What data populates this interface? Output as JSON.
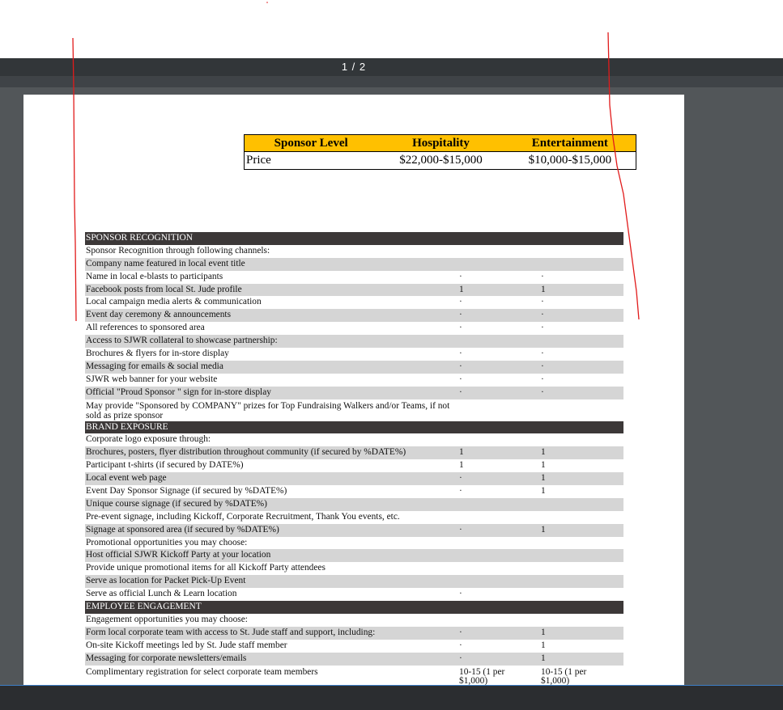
{
  "viewer": {
    "page_counter": "1 / 2",
    "colors": {
      "toolbar": "#323639",
      "background": "#525659",
      "page": "#ffffff",
      "bottom_bar": "#2b2d30"
    }
  },
  "price_table": {
    "header": [
      "Sponsor Level",
      "Hospitality",
      "Entertainment"
    ],
    "row": [
      "Price",
      "$22,000-$15,000",
      "$10,000-$15,000"
    ],
    "header_color": "#ffc000"
  },
  "benefits": {
    "section_color": "#3c3838",
    "shade_color": "#d5d5d5",
    "rows": [
      {
        "type": "section",
        "label": "SPONSOR RECOGNITION",
        "v1": "",
        "v2": ""
      },
      {
        "type": "row",
        "label": "Sponsor Recognition through following channels:",
        "v1": "",
        "v2": ""
      },
      {
        "type": "row",
        "label": "Company name featured in local event title",
        "v1": "",
        "v2": ""
      },
      {
        "type": "row",
        "label": "Name in local e-blasts to participants",
        "v1": "·",
        "v2": "·"
      },
      {
        "type": "row",
        "label": "Facebook posts from local St. Jude profile",
        "v1": "1",
        "v2": "1"
      },
      {
        "type": "row",
        "label": "Local campaign media alerts & communication",
        "v1": "·",
        "v2": "·"
      },
      {
        "type": "row",
        "label": "Event day ceremony & announcements",
        "v1": "·",
        "v2": "·"
      },
      {
        "type": "row",
        "label": "All references to sponsored area",
        "v1": "·",
        "v2": "·"
      },
      {
        "type": "row",
        "label": "Access to SJWR collateral to showcase partnership:",
        "v1": "",
        "v2": ""
      },
      {
        "type": "row",
        "label": "Brochures & flyers for in-store display",
        "v1": "·",
        "v2": "·"
      },
      {
        "type": "row",
        "label": "Messaging for emails & social media",
        "v1": "·",
        "v2": "·"
      },
      {
        "type": "row",
        "label": "SJWR web banner for your website",
        "v1": "·",
        "v2": "·"
      },
      {
        "type": "row",
        "label": "Official \"Proud Sponsor \" sign for in-store display",
        "v1": "·",
        "v2": "·"
      },
      {
        "type": "wrap",
        "label": "May provide \"Sponsored by COMPANY\" prizes for Top Fundraising Walkers and/or Teams, if not sold as prize sponsor",
        "v1": "",
        "v2": ""
      },
      {
        "type": "section",
        "label": "BRAND EXPOSURE",
        "v1": "",
        "v2": ""
      },
      {
        "type": "row",
        "label": "Corporate logo exposure through:",
        "v1": "",
        "v2": ""
      },
      {
        "type": "row",
        "label": "Brochures, posters, flyer distribution throughout community (if secured by %DATE%)",
        "v1": "1",
        "v2": "1"
      },
      {
        "type": "row",
        "label": "Participant t-shirts (if secured by DATE%)",
        "v1": "1",
        "v2": "1"
      },
      {
        "type": "row",
        "label": "Local event web page",
        "v1": "·",
        "v2": "1"
      },
      {
        "type": "row",
        "label": "Event Day Sponsor Signage (if secured by %DATE%)",
        "v1": "·",
        "v2": "1"
      },
      {
        "type": "row",
        "label": "Unique course signage (if secured by %DATE%)",
        "v1": "",
        "v2": ""
      },
      {
        "type": "row",
        "label": "Pre-event signage, including Kickoff, Corporate Recruitment, Thank You events, etc.",
        "v1": "",
        "v2": ""
      },
      {
        "type": "row",
        "label": "Signage at sponsored area (if secured by %DATE%)",
        "v1": "·",
        "v2": "1"
      },
      {
        "type": "row",
        "label": "Promotional opportunities you may choose:",
        "v1": "",
        "v2": ""
      },
      {
        "type": "row",
        "label": "Host official SJWR Kickoff Party at your location",
        "v1": "",
        "v2": ""
      },
      {
        "type": "row",
        "label": "Provide unique promotional items for all Kickoff Party attendees",
        "v1": "",
        "v2": ""
      },
      {
        "type": "row",
        "label": "Serve as location for Packet Pick-Up Event",
        "v1": "",
        "v2": ""
      },
      {
        "type": "row",
        "label": "Serve as official Lunch & Learn location",
        "v1": "·",
        "v2": ""
      },
      {
        "type": "section",
        "label": "EMPLOYEE ENGAGEMENT",
        "v1": "",
        "v2": ""
      },
      {
        "type": "row",
        "label": "Engagement opportunities you may choose:",
        "v1": "",
        "v2": ""
      },
      {
        "type": "row",
        "label": "Form local corporate team with access to St. Jude staff and support, including:",
        "v1": "·",
        "v2": "1"
      },
      {
        "type": "row",
        "label": "On-site Kickoff meetings led by St. Jude staff member",
        "v1": "·",
        "v2": "1"
      },
      {
        "type": "row",
        "label": "Messaging for corporate newsletters/emails",
        "v1": "·",
        "v2": "1"
      },
      {
        "type": "clip",
        "label": "Complimentary registration for select corporate team members",
        "v1": "10-15 (1 per $1,000)",
        "v2": "10-15 (1 per $1,000)"
      }
    ]
  }
}
